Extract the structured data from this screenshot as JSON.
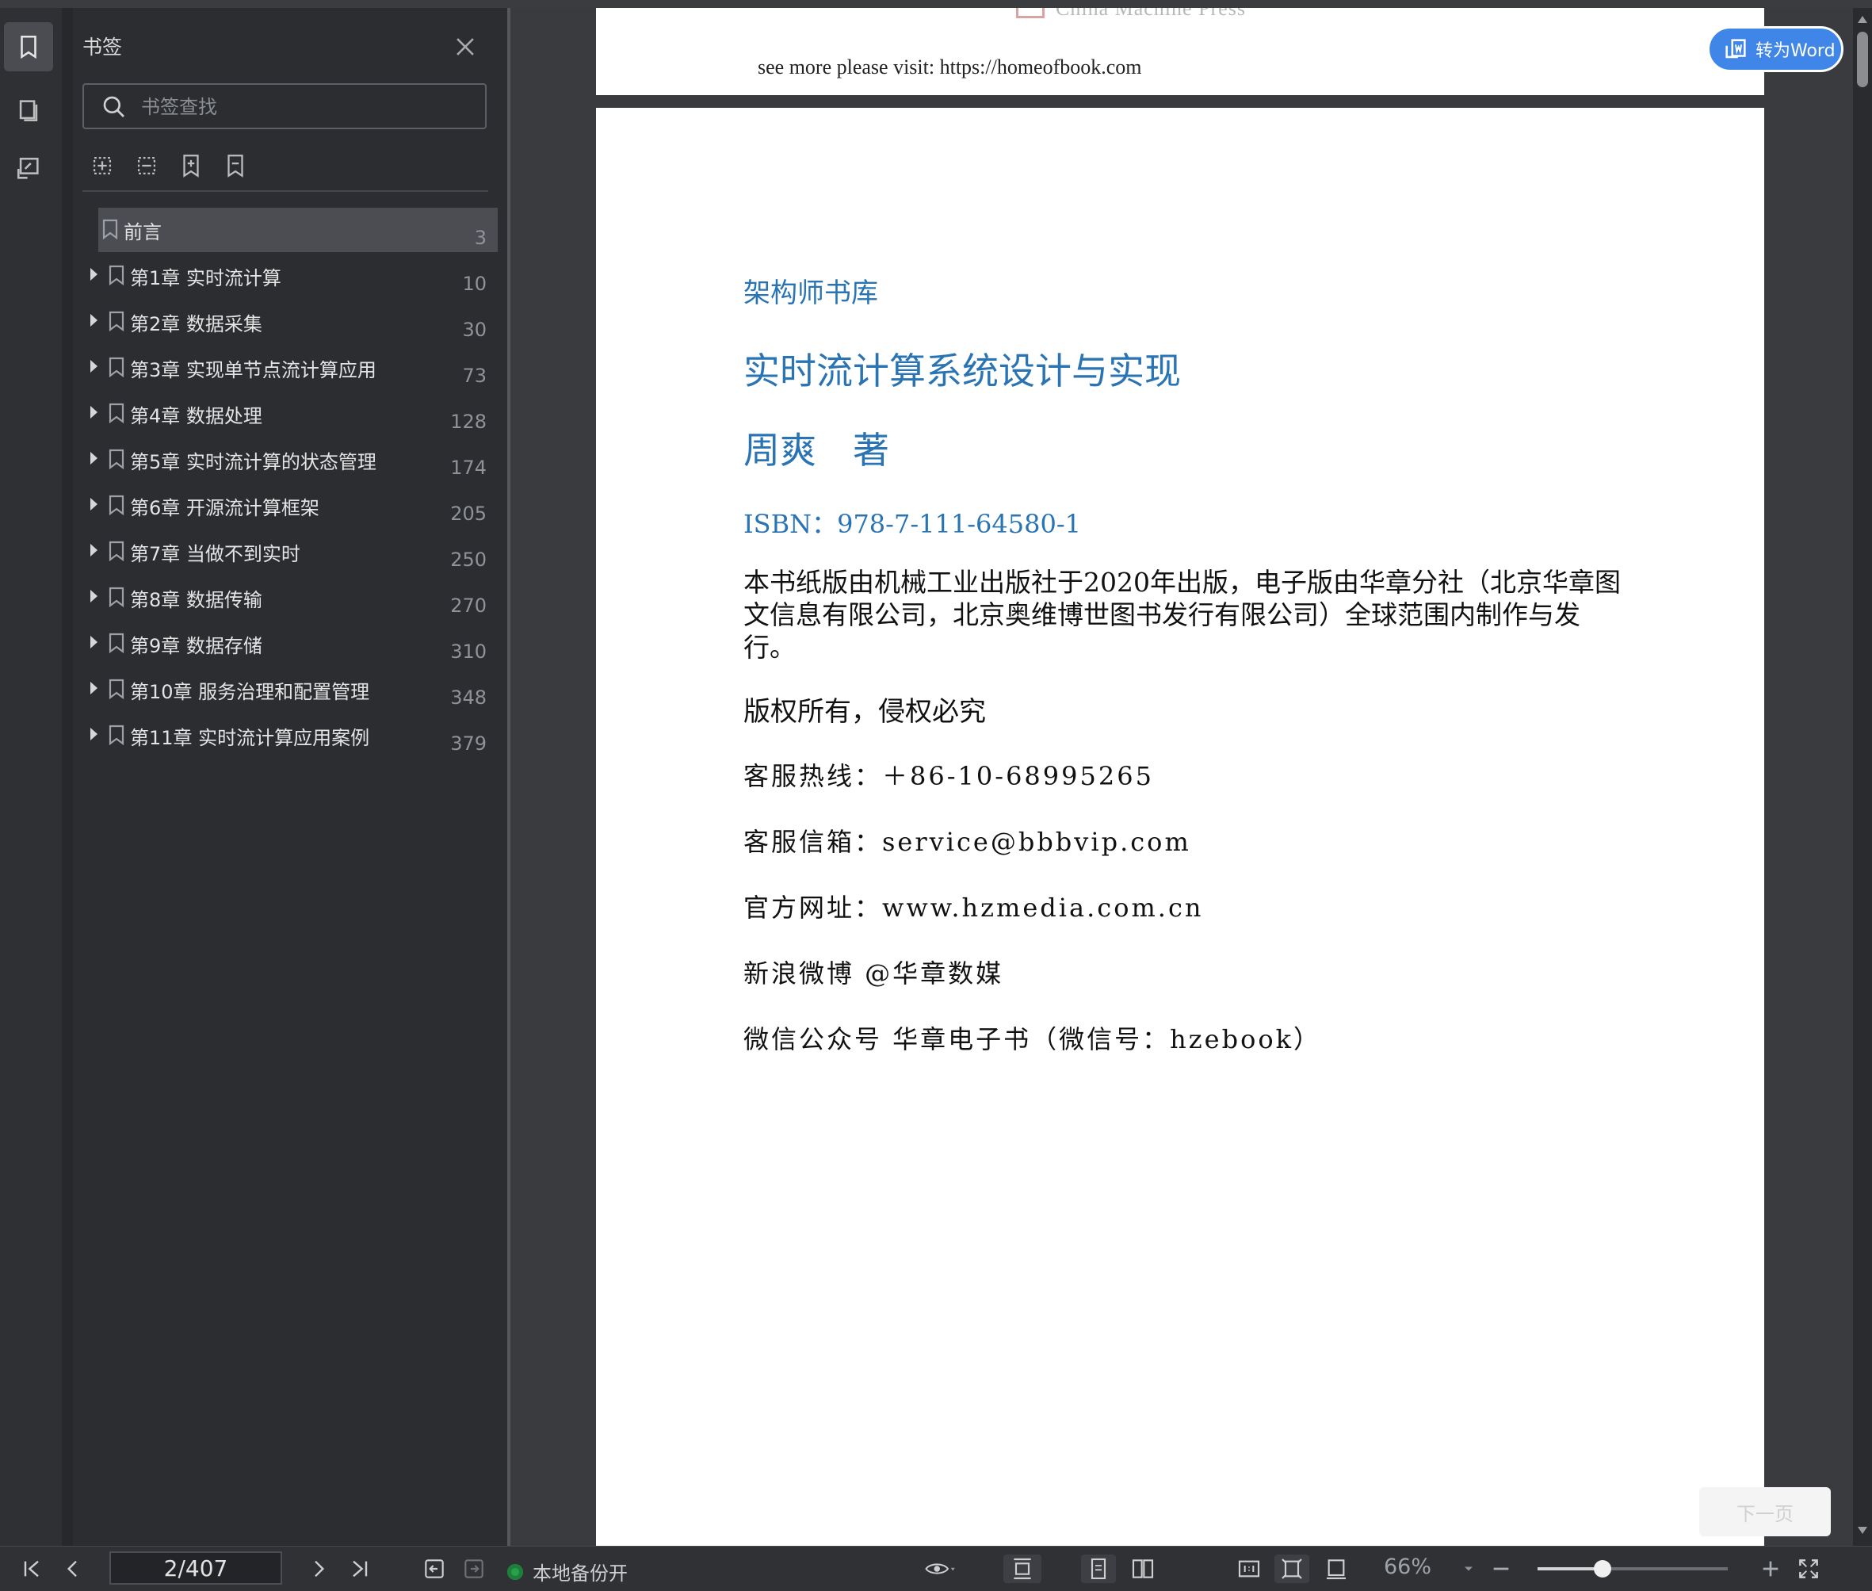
{
  "sidebar": {
    "title": "书签",
    "search_placeholder": "书签查找",
    "bookmarks": [
      {
        "label": "前言",
        "page": "3"
      },
      {
        "label": "第1章 实时流计算",
        "page": "10"
      },
      {
        "label": "第2章 数据采集",
        "page": "30"
      },
      {
        "label": "第3章 实现单节点流计算应用",
        "page": "73"
      },
      {
        "label": "第4章 数据处理",
        "page": "128"
      },
      {
        "label": "第5章 实时流计算的状态管理",
        "page": "174"
      },
      {
        "label": "第6章 开源流计算框架",
        "page": "205"
      },
      {
        "label": "第7章 当做不到实时",
        "page": "250"
      },
      {
        "label": "第8章 数据传输",
        "page": "270"
      },
      {
        "label": "第9章 数据存储",
        "page": "310"
      },
      {
        "label": "第10章 服务治理和配置管理",
        "page": "348"
      },
      {
        "label": "第11章 实时流计算应用案例",
        "page": "379"
      }
    ]
  },
  "document": {
    "prev_page": {
      "visit_text": "see more please visit: https://homeofbook.com",
      "logo_fragment": "China Machine Press"
    },
    "page": {
      "series": "架构师书库",
      "title": "实时流计算系统设计与实现",
      "author": "周爽　著",
      "isbn": "ISBN：978-7-111-64580-1",
      "notice": "本书纸版由机械工业出版社于2020年出版，电子版由华章分社（北京华章图文信息有限公司，北京奥维博世图书发行有限公司）全球范围内制作与发行。",
      "rights": "版权所有，侵权必究",
      "info": [
        "客服热线：＋86-10-68995265",
        "客服信箱：service@bbbvip.com",
        "官方网址：www.hzmedia.com.cn",
        "新浪微博 @华章数媒",
        "微信公众号 华章电子书（微信号：hzebook）"
      ]
    },
    "convert_button": "转为Word",
    "faded_button": "下一页"
  },
  "statusbar": {
    "page_indicator": "2/407",
    "backup_text": "本地备份开",
    "zoom": "66%",
    "zoom_level": 0.34
  },
  "colors": {
    "accent_blue": "#3f86e8",
    "heading_blue": "#2a74b4",
    "backup_green": "#26a34a"
  }
}
